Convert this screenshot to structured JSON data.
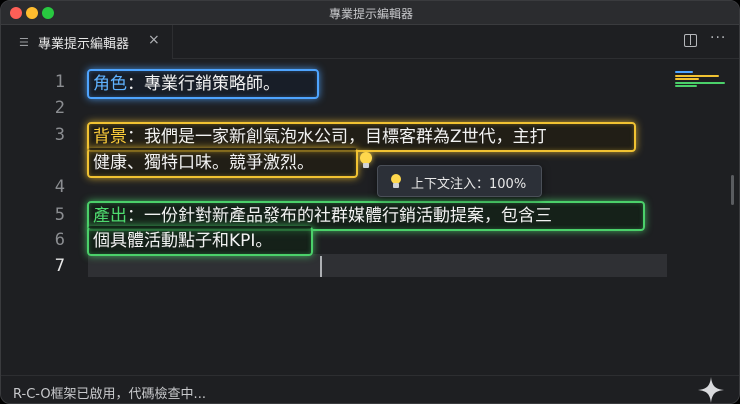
{
  "window": {
    "title": "專業提示編輯器"
  },
  "tab": {
    "label": "專業提示編輯器",
    "icon": "list-icon",
    "close": "×"
  },
  "toolbar": {
    "split_icon": "split-editor-icon",
    "more_label": "···"
  },
  "editor": {
    "line_numbers": [
      "1",
      "2",
      "3",
      "4",
      "5",
      "6",
      "7"
    ],
    "role": {
      "key": "角色",
      "sep": "：",
      "text": "專業行銷策略師。"
    },
    "background": {
      "key": "背景",
      "line1_rest": "：我們是一家新創氣泡水公司，目標客群為Z世代，主打",
      "line2": "健康、獨特口味。競爭激烈。"
    },
    "output": {
      "key": "產出",
      "line1_rest": "：一份針對新產品發布的社群媒體行銷活動提案，包含三",
      "line2": "個具體活動點子和KPI。"
    }
  },
  "tooltip": {
    "text": "上下文注入：100%"
  },
  "status": {
    "text": "R-C-O框架已啟用，代碼檢查中..."
  },
  "colors": {
    "role": "#4ea4ff",
    "background": "#f1c232",
    "output": "#4bd06a",
    "editor_bg": "#1e1f22"
  }
}
